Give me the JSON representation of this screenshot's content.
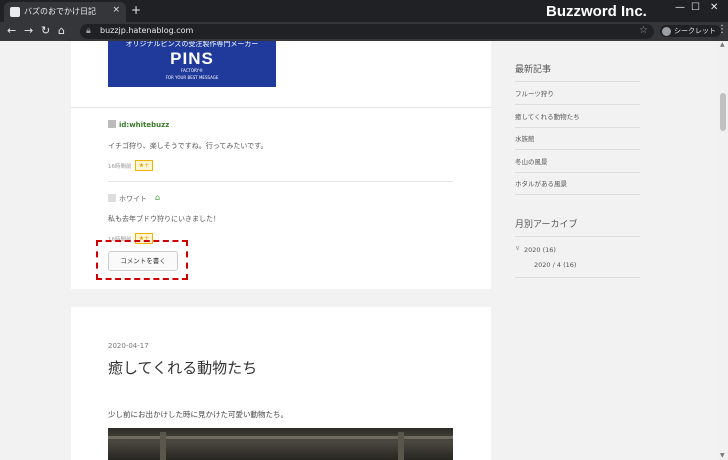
{
  "browser": {
    "tab_title": "バズのおでかけ日記",
    "tab_close": "×",
    "new_tab": "+",
    "brand": "Buzzword Inc.",
    "url": "buzzjp.hatenablog.com",
    "profile_label": "シークレット",
    "icons": [
      "back-icon",
      "forward-icon",
      "reload-icon",
      "home-icon",
      "lock-icon",
      "star-icon",
      "menu-icon"
    ]
  },
  "banner": {
    "tagline": "オリジナルピンズの受注製作専門メーカー",
    "logo": "PINS",
    "logo_sub": "FACTORY®",
    "slogan": "FOR YOUR BEST MESSAGE"
  },
  "comments": [
    {
      "user": "id:whitebuzz",
      "text": "イチゴ狩り、楽しそうですね。行ってみたいです。",
      "time": "16時間前",
      "star": "★+"
    },
    {
      "user": "ホワイト",
      "text": "私も去年ブドウ狩りにいきました！",
      "time": "16時間前",
      "star": "★+"
    }
  ],
  "comment_button": "コメントを書く",
  "post": {
    "date": "2020-04-17",
    "title": "癒してくれる動物たち",
    "text": "少し前にお出かけした時に見かけた可愛い動物たち。"
  },
  "sidebar": {
    "recent_heading": "最新記事",
    "recent_items": [
      "フルーツ狩り",
      "癒してくれる動物たち",
      "水族館",
      "冬山の風景",
      "ホタルがある風景"
    ],
    "archive_heading": "月別アーカイブ",
    "archive_year": "2020 (16)",
    "archive_month": "2020 / 4 (16)"
  },
  "colors": {
    "accent_red": "#d00000",
    "banner_blue": "#1f3a9a",
    "user_green": "#3b7a2a"
  }
}
